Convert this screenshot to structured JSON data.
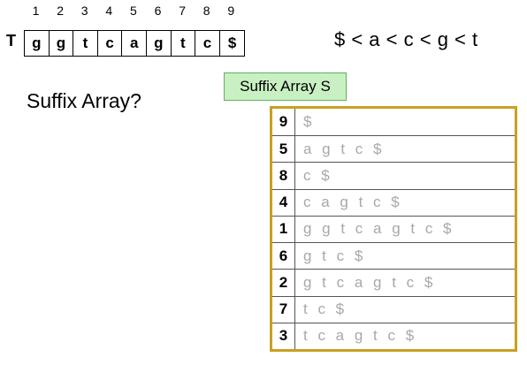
{
  "text_row": {
    "label": "T",
    "indices": [
      "1",
      "2",
      "3",
      "4",
      "5",
      "6",
      "7",
      "8",
      "9"
    ],
    "chars": [
      "g",
      "g",
      "t",
      "c",
      "a",
      "g",
      "t",
      "c",
      "$"
    ]
  },
  "ordering": "$ < a < c < g < t",
  "question": "Suffix Array?",
  "sa_badge": "Suffix Array S",
  "suffix_array": [
    {
      "index": "9",
      "suffix": "$"
    },
    {
      "index": "5",
      "suffix": "a g t c $"
    },
    {
      "index": "8",
      "suffix": "c $"
    },
    {
      "index": "4",
      "suffix": "c a g t c $"
    },
    {
      "index": "1",
      "suffix": "g g t c a g t c $"
    },
    {
      "index": "6",
      "suffix": "g t c $"
    },
    {
      "index": "2",
      "suffix": "g t c a g t c $"
    },
    {
      "index": "7",
      "suffix": "t c $"
    },
    {
      "index": "3",
      "suffix": "t c a g t c $"
    }
  ],
  "colors": {
    "table_border": "#c8a022",
    "badge_bg": "#c9f0c3",
    "suffix_text": "#a8a8a8"
  }
}
